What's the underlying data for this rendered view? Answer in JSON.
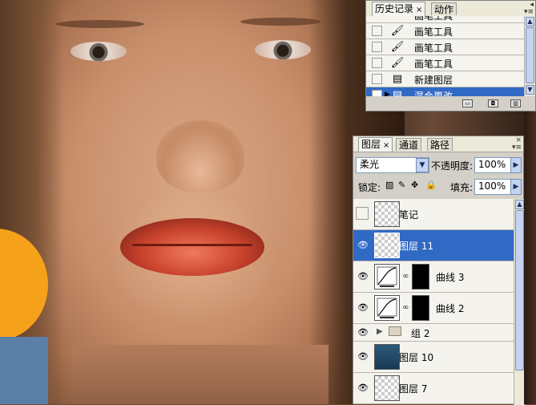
{
  "canvas": {
    "description_free": true
  },
  "history_panel": {
    "tabs": [
      {
        "label": "历史记录",
        "close": "×",
        "active": true
      },
      {
        "label": "动作",
        "active": false
      }
    ],
    "rows": [
      {
        "icon": "brush-icon",
        "label": "画笔工具",
        "selected": false
      },
      {
        "icon": "brush-icon",
        "label": "画笔工具",
        "selected": false
      },
      {
        "icon": "brush-icon",
        "label": "画笔工具",
        "selected": false
      },
      {
        "icon": "document-icon",
        "label": "新建图层",
        "selected": false
      },
      {
        "icon": "document-icon",
        "label": "混合更改",
        "selected": true
      }
    ],
    "top_partial_label": "画笔工具"
  },
  "layers_panel": {
    "tabs": [
      {
        "label": "图层",
        "close": "×",
        "active": true
      },
      {
        "label": "通道",
        "active": false
      },
      {
        "label": "路径",
        "active": false
      }
    ],
    "blend_mode": "柔光",
    "opacity_label": "不透明度:",
    "opacity_value": "100%",
    "lock_label": "锁定:",
    "fill_label": "填充:",
    "fill_value": "100%",
    "layers": [
      {
        "name": "笔记",
        "visible": false,
        "thumb": "transparent",
        "selected": false
      },
      {
        "name": "图层 11",
        "visible": true,
        "thumb": "transparent",
        "selected": true
      },
      {
        "name": "曲线 3",
        "visible": true,
        "thumb": "curve",
        "mask": true,
        "selected": false
      },
      {
        "name": "曲线 2",
        "visible": true,
        "thumb": "curve",
        "mask": true,
        "selected": false
      },
      {
        "name": "组 2",
        "visible": true,
        "thumb": "folder",
        "selected": false
      },
      {
        "name": "图层 10",
        "visible": true,
        "thumb": "photo",
        "selected": false
      },
      {
        "name": "图层 7",
        "visible": true,
        "thumb": "transparent",
        "selected": false
      }
    ]
  },
  "colors": {
    "selection": "#316ac5",
    "panel_bg": "#d4d0c8",
    "tab_bar": "#ece9d8"
  }
}
